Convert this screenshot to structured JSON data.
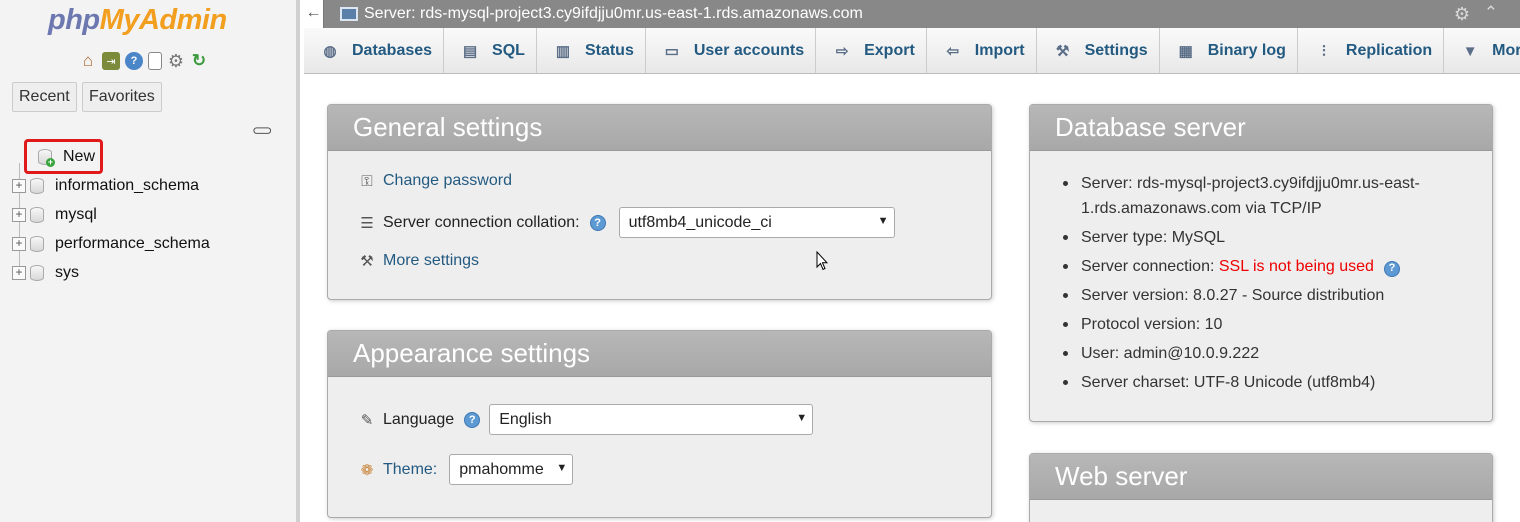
{
  "nav": {
    "logo_php": "php",
    "logo_myadmin": "MyAdmin",
    "tabs": {
      "recent": "Recent",
      "favorites": "Favorites"
    },
    "tree": {
      "new_label": "New",
      "databases": [
        "information_schema",
        "mysql",
        "performance_schema",
        "sys"
      ]
    }
  },
  "topbar": {
    "title": "Server: rds-mysql-project3.cy9ifdjju0mr.us-east-1.rds.amazonaws.com"
  },
  "menu": {
    "tabs": [
      "Databases",
      "SQL",
      "Status",
      "User accounts",
      "Export",
      "Import",
      "Settings",
      "Binary log",
      "Replication",
      "More"
    ]
  },
  "general": {
    "title": "General settings",
    "change_password": "Change password",
    "collation_label": "Server connection collation:",
    "collation_value": "utf8mb4_unicode_ci",
    "more_settings": "More settings"
  },
  "appearance": {
    "title": "Appearance settings",
    "language_label": "Language",
    "language_value": "English",
    "theme_label": "Theme:",
    "theme_value": "pmahomme"
  },
  "dbserver": {
    "title": "Database server",
    "server": "Server: rds-mysql-project3.cy9ifdjju0mr.us-east-1.rds.amazonaws.com via TCP/IP",
    "server_type": "Server type: MySQL",
    "connection_label": "Server connection: ",
    "connection_value": "SSL is not being used",
    "version": "Server version: 8.0.27 - Source distribution",
    "protocol": "Protocol version: 10",
    "user": "User: admin@10.0.9.222",
    "charset": "Server charset: UTF-8 Unicode (utf8mb4)"
  },
  "web": {
    "title": "Web server"
  },
  "colors": {
    "link": "#235a81",
    "panel_header": "#aaaaaa",
    "ssl_warning": "#ee0000",
    "highlight": "#e01a1a"
  }
}
